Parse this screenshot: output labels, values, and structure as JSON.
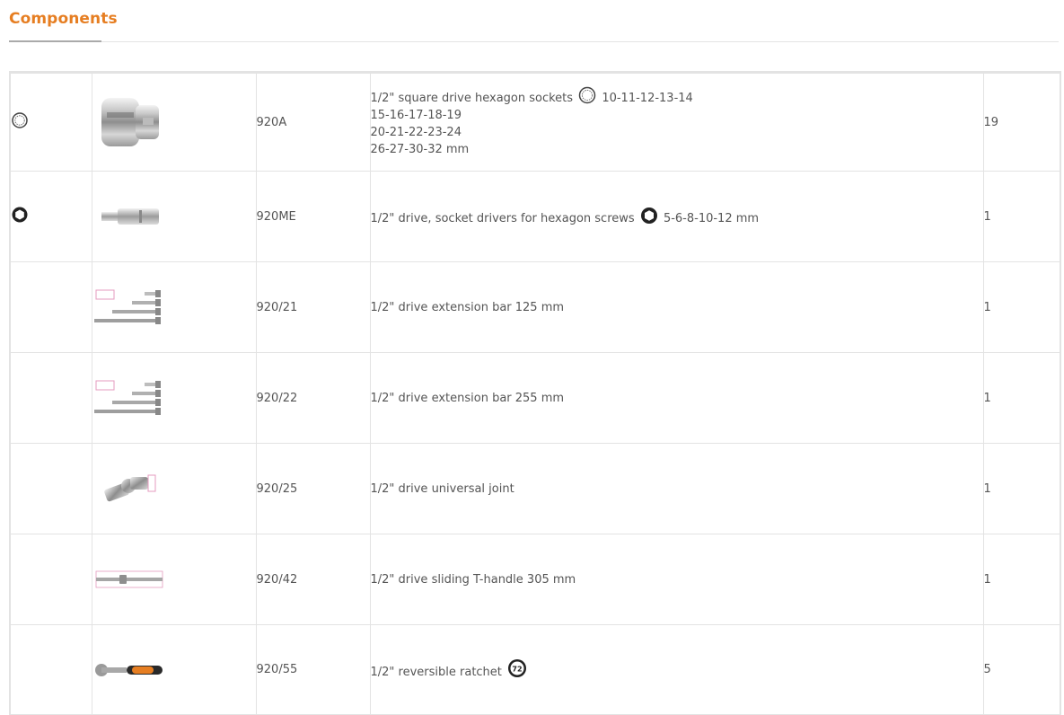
{
  "section": {
    "title": "Components"
  },
  "table": {
    "rows": [
      {
        "icon": "12-point-socket-icon",
        "code": "920A",
        "desc_lead": "1/2\" square drive hexagon sockets",
        "desc_icon": "12-point-socket-icon",
        "desc_rest": "10-11-12-13-14",
        "desc_more": [
          "15-16-17-18-19",
          "20-21-22-23-24",
          "26-27-30-32 mm"
        ],
        "qty": "19"
      },
      {
        "icon": "hexagon-socket-icon",
        "code": "920ME",
        "desc_lead": "1/2\" drive, socket drivers for hexagon screws",
        "desc_icon": "hexagon-socket-icon",
        "desc_rest": "5-6-8-10-12 mm",
        "qty": "1"
      },
      {
        "code": "920/21",
        "desc": "1/2\" drive extension bar 125 mm",
        "qty": "1"
      },
      {
        "code": "920/22",
        "desc": "1/2\" drive extension bar 255 mm",
        "qty": "1"
      },
      {
        "code": "920/25",
        "desc": "1/2\" drive universal joint",
        "qty": "1"
      },
      {
        "code": "920/42",
        "desc": "1/2\" drive sliding T-handle 305 mm",
        "qty": "1"
      },
      {
        "code": "920/55",
        "desc_lead": "1/2\" reversible ratchet",
        "desc_icon": "72-teeth-badge-icon",
        "qty": "5"
      }
    ]
  },
  "colors": {
    "accent": "#e67e22",
    "border": "#e3e3e3",
    "text": "#555555"
  }
}
